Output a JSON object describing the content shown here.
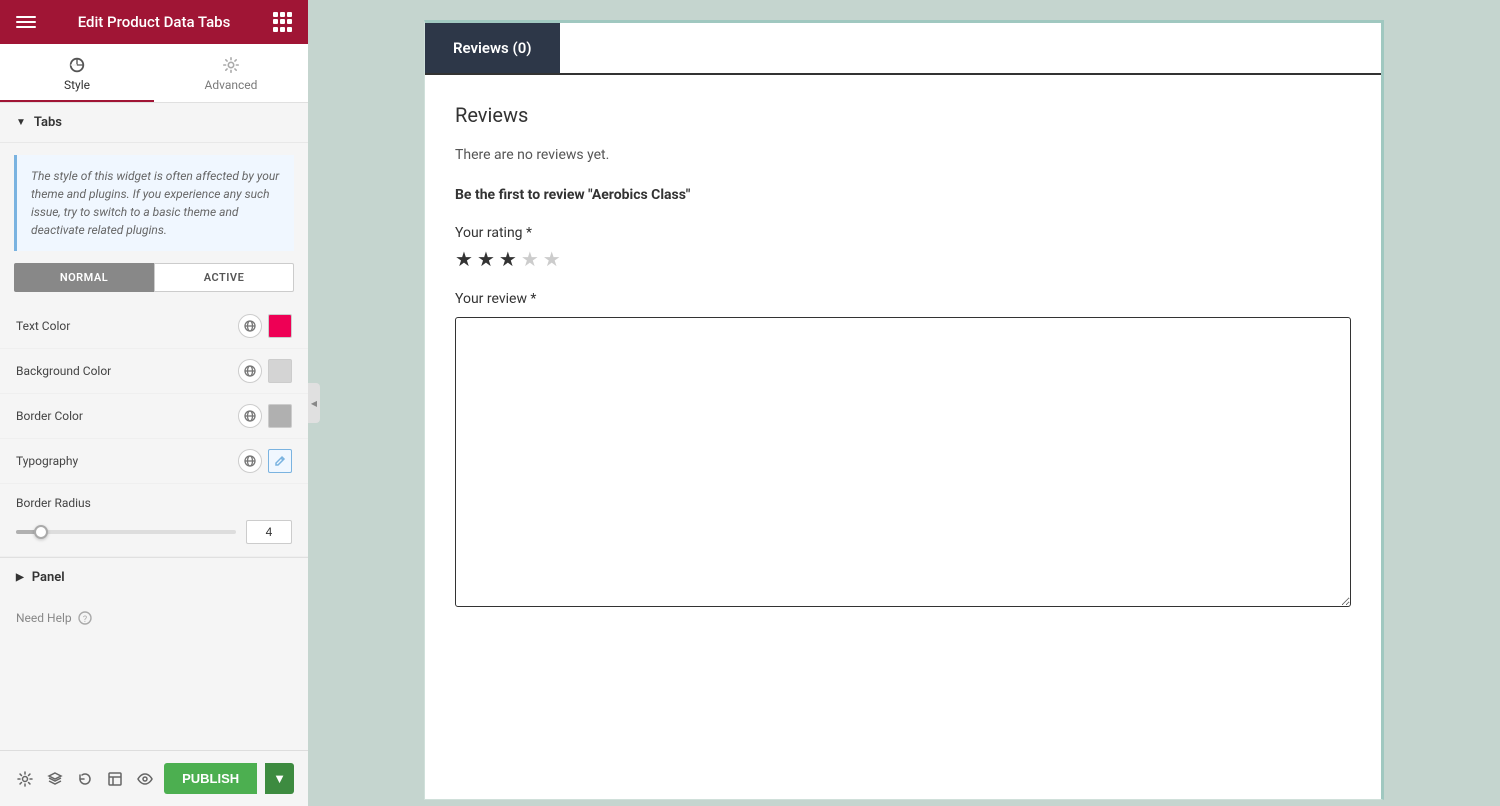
{
  "header": {
    "title": "Edit Product Data Tabs",
    "hamburger_label": "menu",
    "grid_label": "apps"
  },
  "panel_tabs": [
    {
      "id": "style",
      "label": "Style",
      "icon": "circle-half"
    },
    {
      "id": "advanced",
      "label": "Advanced",
      "icon": "gear"
    }
  ],
  "active_panel_tab": "style",
  "sections": {
    "tabs_section": {
      "label": "Tabs",
      "info_text": "The style of this widget is often affected by your theme and plugins. If you experience any such issue, try to switch to a basic theme and deactivate related plugins.",
      "state_buttons": [
        "NORMAL",
        "ACTIVE"
      ],
      "active_state": "NORMAL",
      "controls": [
        {
          "id": "text-color",
          "label": "Text Color",
          "swatch_type": "red"
        },
        {
          "id": "background-color",
          "label": "Background Color",
          "swatch_type": "light-gray"
        },
        {
          "id": "border-color",
          "label": "Border Color",
          "swatch_type": "gray"
        },
        {
          "id": "typography",
          "label": "Typography",
          "swatch_type": "pencil"
        }
      ],
      "border_radius": {
        "label": "Border Radius",
        "value": "4",
        "slider_percent": 10
      }
    },
    "panel_section": {
      "label": "Panel"
    }
  },
  "bottom_bar": {
    "publish_label": "PUBLISH",
    "icons": [
      "settings",
      "layers",
      "history",
      "template",
      "eye"
    ]
  },
  "need_help": "Need Help",
  "main_content": {
    "tab_label": "Reviews (0)",
    "reviews_title": "Reviews",
    "no_reviews_text": "There are no reviews yet.",
    "first_review_label": "Be the first to review \"Aerobics Class\"",
    "rating_label": "Your rating *",
    "stars": [
      true,
      true,
      true,
      false,
      false
    ],
    "review_label": "Your review *"
  }
}
